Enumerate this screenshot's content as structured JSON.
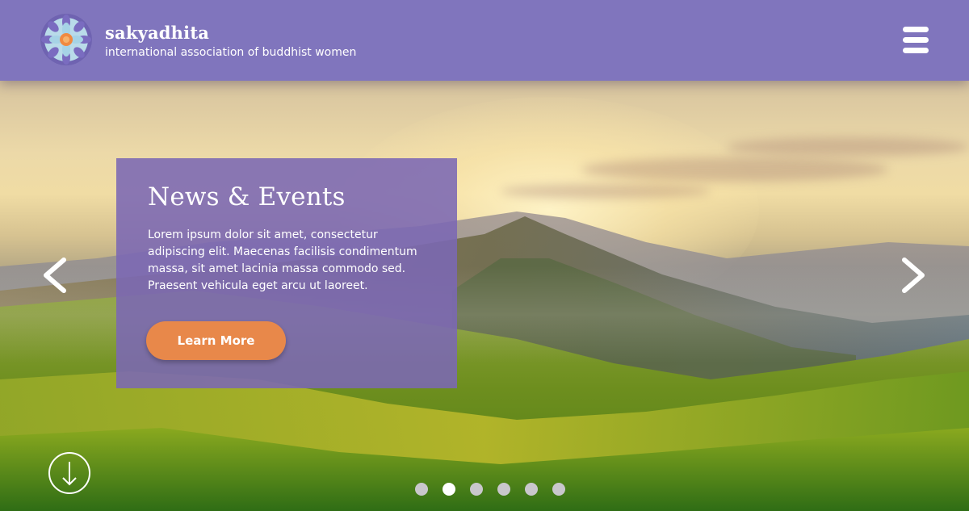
{
  "header": {
    "brand_name": "sakyadhita",
    "tagline": "international association of buddhist women",
    "logo_icon": "lotus-mandala-icon",
    "menu_icon": "hamburger-menu-icon"
  },
  "hero": {
    "title": "News & Events",
    "body": "Lorem ipsum dolor sit amet, consectetur adipiscing elit. Maecenas facilisis condimentum massa, sit amet lacinia massa commodo sed. Praesent vehicula eget arcu ut laoreet.",
    "cta_label": "Learn More",
    "prev_icon": "chevron-left-icon",
    "next_icon": "chevron-right-icon",
    "scroll_icon": "arrow-down-icon"
  },
  "carousel": {
    "slide_count": 6,
    "active_index": 1
  },
  "colors": {
    "header_bg": "#8075bd",
    "card_bg": "#7b68b4",
    "accent_button": "#e8884a",
    "text": "#ffffff",
    "dot_inactive": "#c9c7cc",
    "dot_active": "#ffffff"
  }
}
